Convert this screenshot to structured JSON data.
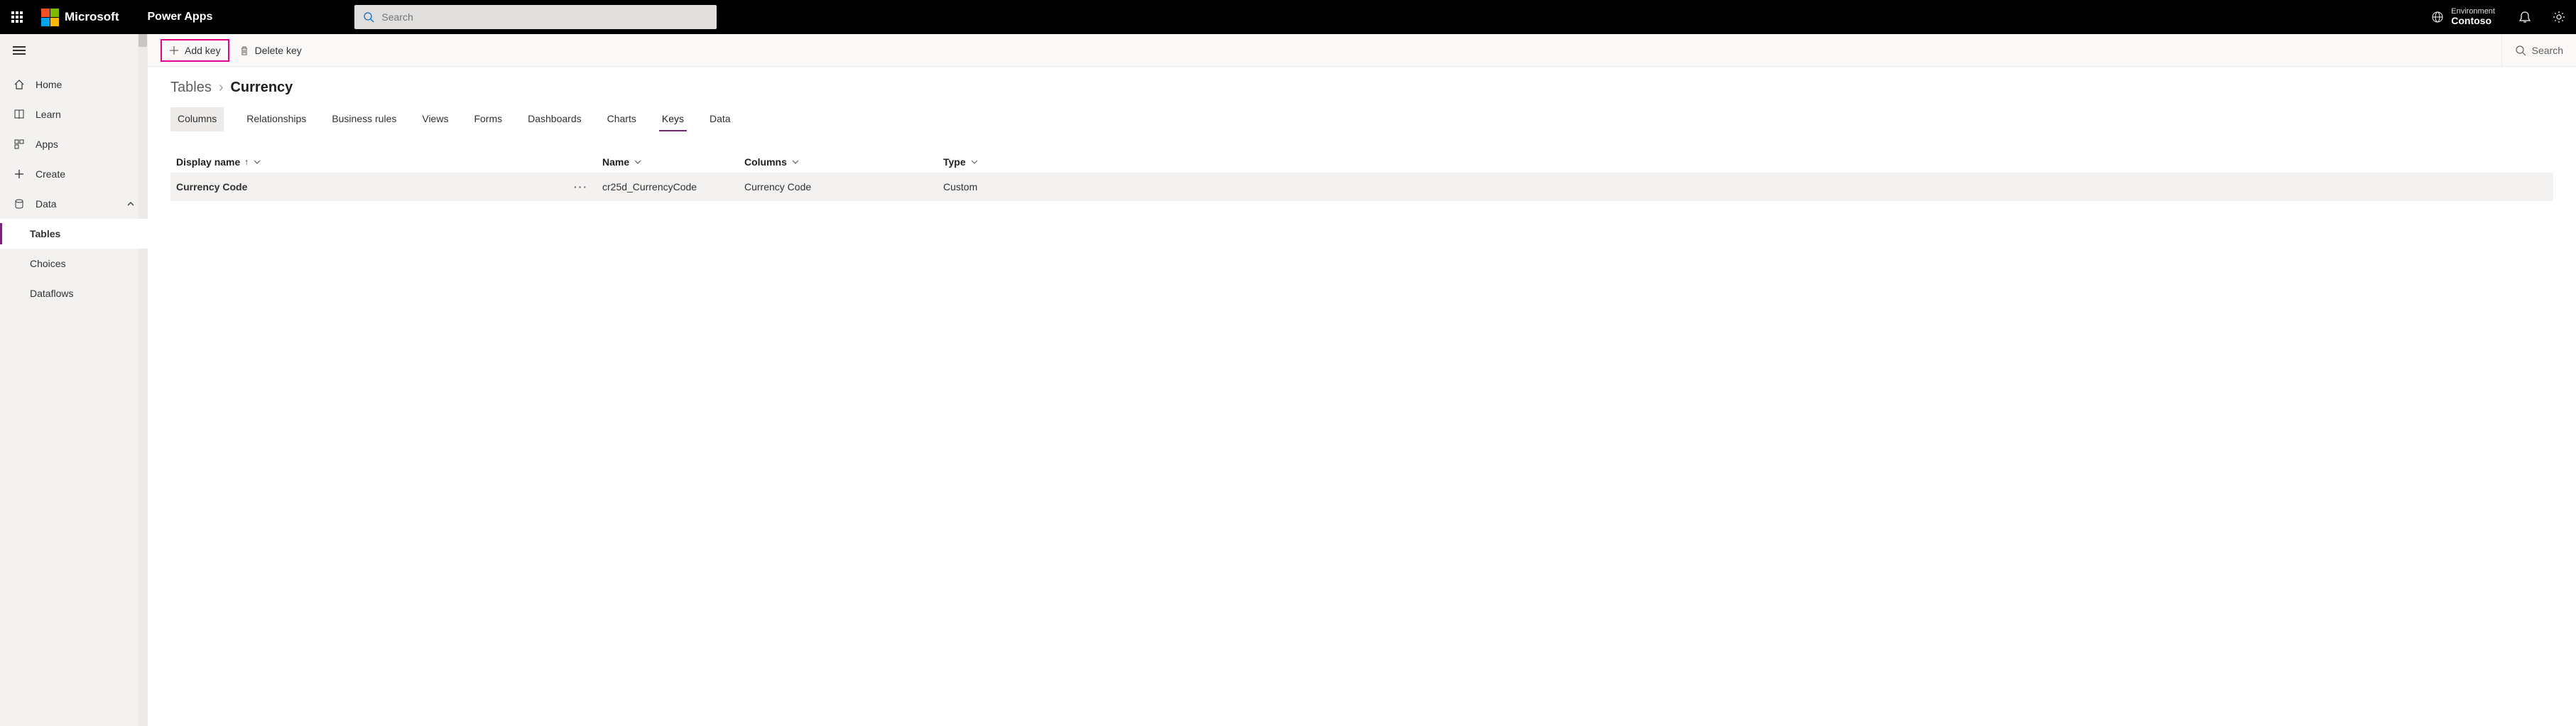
{
  "header": {
    "brand": "Microsoft",
    "app": "Power Apps",
    "search_placeholder": "Search",
    "env_label": "Environment",
    "env_name": "Contoso"
  },
  "nav": {
    "home": "Home",
    "learn": "Learn",
    "apps": "Apps",
    "create": "Create",
    "data": "Data",
    "tables": "Tables",
    "choices": "Choices",
    "dataflows": "Dataflows"
  },
  "cmd": {
    "add_key": "Add key",
    "delete_key": "Delete key",
    "search": "Search"
  },
  "breadcrumb": {
    "parent": "Tables",
    "current": "Currency"
  },
  "tabs": {
    "columns": "Columns",
    "relationships": "Relationships",
    "business_rules": "Business rules",
    "views": "Views",
    "forms": "Forms",
    "dashboards": "Dashboards",
    "charts": "Charts",
    "keys": "Keys",
    "data": "Data"
  },
  "grid": {
    "headers": {
      "display_name": "Display name",
      "name": "Name",
      "columns": "Columns",
      "type": "Type"
    },
    "row": {
      "display_name": "Currency Code",
      "name": "cr25d_CurrencyCode",
      "columns": "Currency Code",
      "type": "Custom"
    }
  }
}
